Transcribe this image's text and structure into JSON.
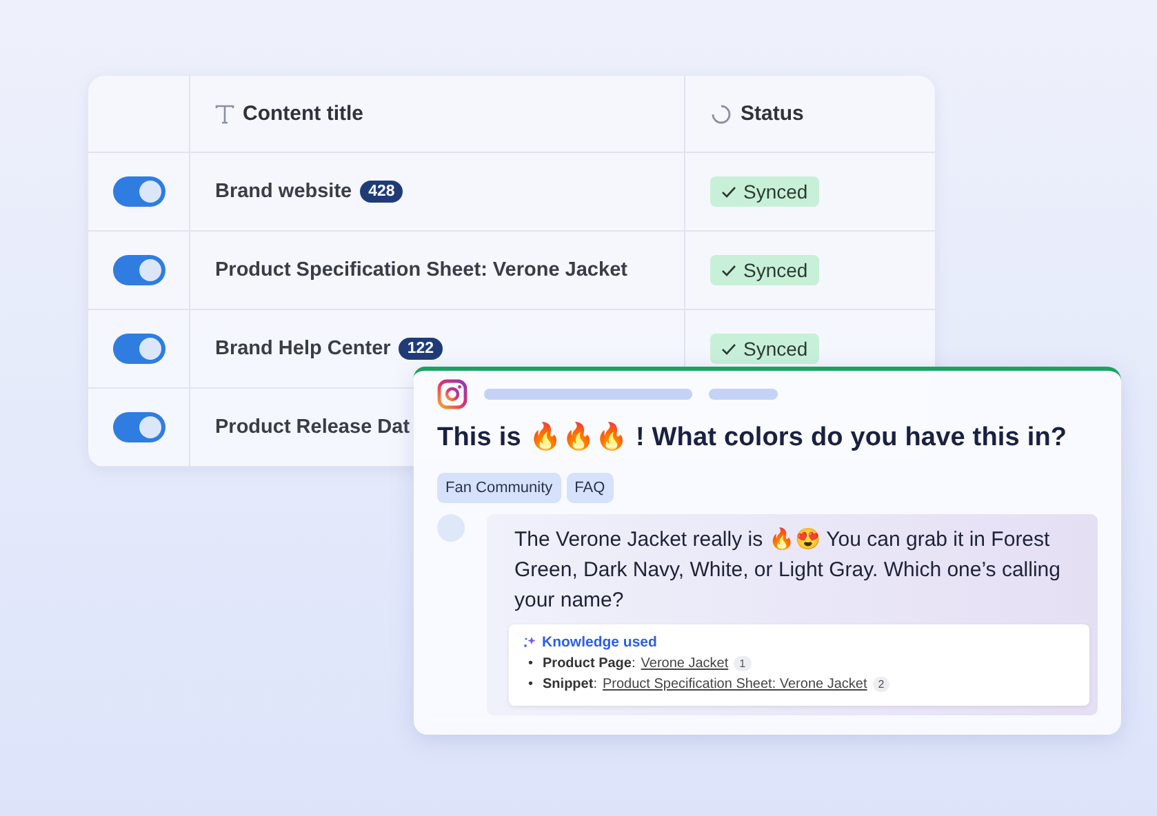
{
  "table": {
    "columns": [
      {
        "kind": "toggle"
      },
      {
        "kind": "text",
        "label": "Content title"
      },
      {
        "kind": "status",
        "label": "Status"
      }
    ],
    "rows": [
      {
        "on": true,
        "title": "Brand website",
        "count": "428",
        "status": "Synced"
      },
      {
        "on": true,
        "title": "Product Specification Sheet: Verone Jacket",
        "status": "Synced"
      },
      {
        "on": true,
        "title": "Brand Help Center",
        "count": "122",
        "status": "Synced"
      },
      {
        "on": true,
        "title": "Product Release Dat"
      }
    ]
  },
  "conversation": {
    "question": "This is 🔥🔥🔥 ! What colors do you have this in?",
    "tags": [
      "Fan Community",
      "FAQ"
    ],
    "reply": "The Verone Jacket really is 🔥😍 You can grab it in Forest Green, Dark Navy, White, or Light Gray. Which one’s calling your name?",
    "knowledge": {
      "title": "Knowledge used",
      "items": [
        {
          "bullet": "•",
          "source": "**Product Page**:",
          "title": "Verone Jacket",
          "ref": "1"
        },
        {
          "bullet": "•",
          "source": "**Snippet**:",
          "title": "Product Specification Sheet: Verone Jacket",
          "ref": "2"
        }
      ]
    }
  }
}
